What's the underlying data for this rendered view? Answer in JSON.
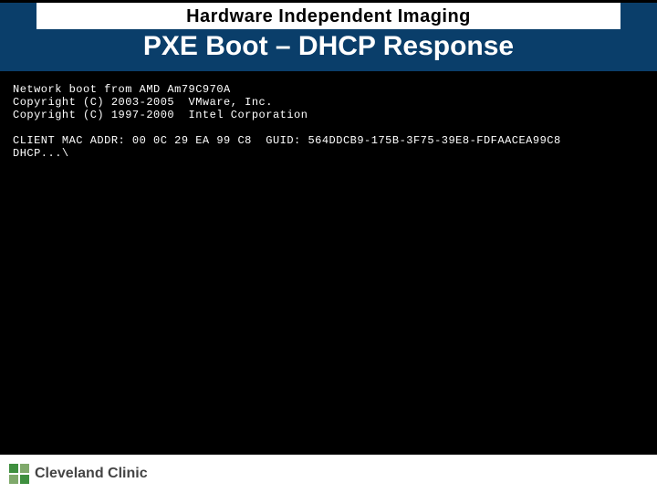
{
  "header": {
    "subtitle": "Hardware Independent Imaging",
    "title": "PXE Boot – DHCP Response"
  },
  "console": {
    "line1": "Network boot from AMD Am79C970A",
    "line2": "Copyright (C) 2003-2005  VMware, Inc.",
    "line3": "Copyright (C) 1997-2000  Intel Corporation",
    "blank1": "",
    "line4": "CLIENT MAC ADDR: 00 0C 29 EA 99 C8  GUID: 564DDCB9-175B-3F75-39E8-FDFAACEA99C8",
    "line5": "DHCP...\\"
  },
  "footer": {
    "org": "Cleveland Clinic"
  }
}
